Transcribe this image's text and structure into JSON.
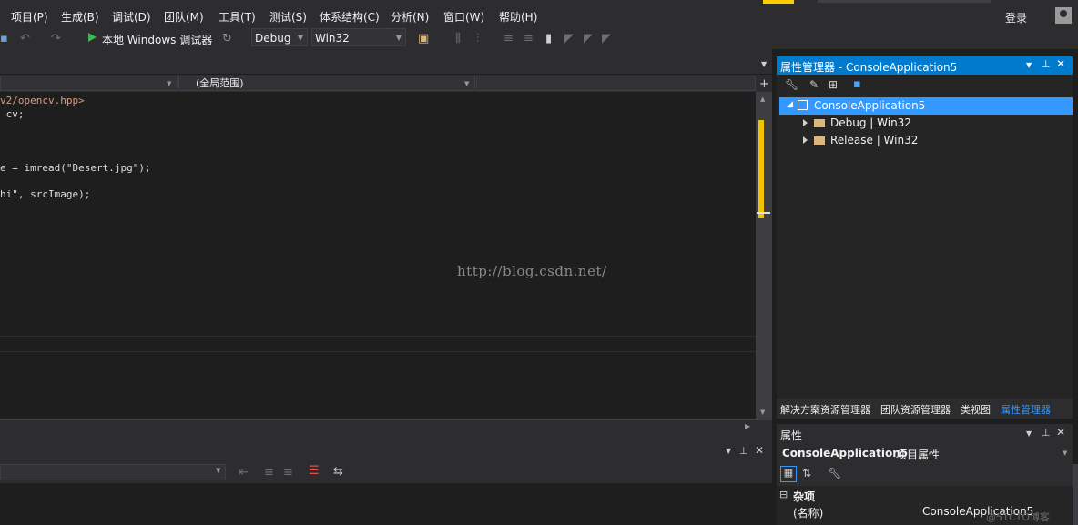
{
  "menu": {
    "items": [
      "项目(P)",
      "生成(B)",
      "调试(D)",
      "团队(M)",
      "工具(T)",
      "测试(S)",
      "体系结构(C)",
      "分析(N)",
      "窗口(W)",
      "帮助(H)"
    ],
    "login": "登录"
  },
  "toolbar": {
    "run_label": "本地 Windows 调试器",
    "config": "Debug",
    "platform": "Win32"
  },
  "editor": {
    "scope_combo": "(全局范围)",
    "code_lines": [
      "v2/opencv.hpp>",
      " cv;",
      "e = imread(\"Desert.jpg\");",
      "hi\", srcImage);"
    ],
    "watermark": "http://blog.csdn.net/"
  },
  "property_manager": {
    "title": "属性管理器 - ConsoleApplication5",
    "tree": {
      "root": "ConsoleApplication5",
      "children": [
        "Debug | Win32",
        "Release | Win32"
      ]
    },
    "tabs": [
      "解决方案资源管理器",
      "团队资源管理器",
      "类视图",
      "属性管理器"
    ],
    "active_tab": "属性管理器"
  },
  "properties": {
    "title": "属性",
    "object_name": "ConsoleApplication5",
    "object_type": "项目属性",
    "category": "杂项",
    "rows": [
      {
        "name": "(名称)",
        "value": "ConsoleApplication5"
      }
    ],
    "watermark": "@51CTO博客"
  },
  "colors": {
    "accent": "#007acc",
    "selection": "#3399ff",
    "scroll_marker": "#f0c300",
    "run_green": "#2fbf4a"
  }
}
